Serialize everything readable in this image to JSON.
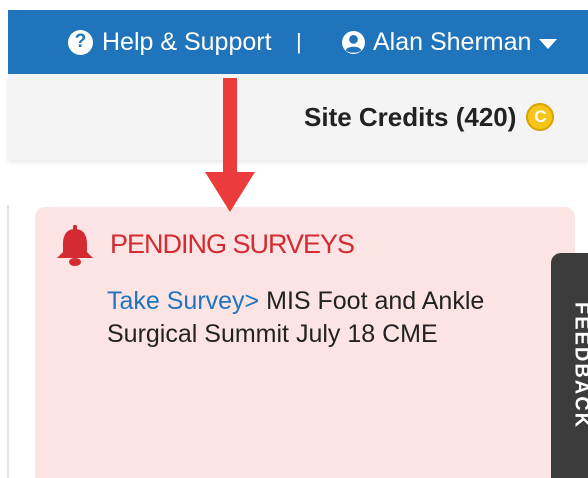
{
  "topbar": {
    "help_label": "Help & Support",
    "help_icon": "question-circle-icon",
    "separator": "|",
    "user_name": "Alan Sherman",
    "user_icon": "user-circle-icon",
    "caret_icon": "caret-down-icon"
  },
  "credits": {
    "label": "Site Credits (420)",
    "coin_icon": "coin-icon",
    "coin_letter": "C"
  },
  "survey": {
    "title": "PENDING SURVEYS",
    "bell_icon": "bell-icon",
    "link_label": "Take Survey>",
    "description": " MIS Foot and Ankle Surgical Summit July 18 CME"
  },
  "feedback": {
    "label": "FEEDBACK"
  },
  "annotation": {
    "arrow_icon": "red-arrow-down-icon"
  },
  "colors": {
    "topbar_bg": "#1f74bb",
    "credits_bg": "#f4f4f4",
    "card_bg": "#fce4e4",
    "title_red": "#d42a31",
    "link_blue": "#1f74bb",
    "feedback_bg": "#3c3c3c",
    "arrow_red": "#ec3b3b",
    "coin_gold": "#f5c518"
  }
}
